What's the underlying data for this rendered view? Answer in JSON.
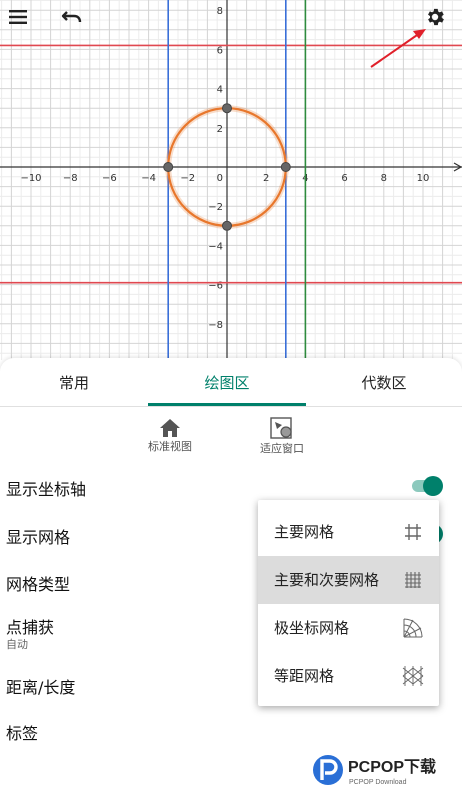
{
  "toolbar": {
    "menu_icon": "hamburger-menu-icon",
    "undo_icon": "undo-arrow-icon",
    "settings_icon": "gear-icon"
  },
  "graph": {
    "x_ticks": [
      -10,
      -8,
      -6,
      -4,
      -2,
      2,
      4,
      6,
      8,
      10
    ],
    "y_ticks": [
      8,
      6,
      4,
      2,
      -2,
      -4,
      -6,
      -8
    ],
    "origin_label": "0",
    "circle": {
      "cx": 0,
      "cy": 0,
      "r": 3
    },
    "points": [
      [
        0,
        3
      ],
      [
        3,
        0
      ],
      [
        0,
        -3
      ],
      [
        -3,
        0
      ]
    ],
    "vertical_lines": [
      {
        "x": -3,
        "color": "#3a6fd8"
      },
      {
        "x": 3,
        "color": "#3a6fd8"
      },
      {
        "x": 4,
        "color": "#2e8b3e"
      }
    ],
    "horizontal_lines": [
      {
        "y": 6.2,
        "color": "#e04850"
      },
      {
        "y": -5.9,
        "color": "#e04850"
      }
    ],
    "curve_color": "#e8772c",
    "annotation_arrow_color": "#e0202a"
  },
  "tabs": [
    {
      "label": "常用",
      "active": false
    },
    {
      "label": "绘图区",
      "active": true
    },
    {
      "label": "代数区",
      "active": false
    }
  ],
  "tools": {
    "standard_view": {
      "label": "标准视图",
      "icon": "home-icon"
    },
    "fit_window": {
      "label": "适应窗口",
      "icon": "fit-window-icon"
    }
  },
  "settings": {
    "show_axes": "显示坐标轴",
    "show_grid": "显示网格",
    "grid_type": "网格类型",
    "point_capture": "点捕获",
    "point_capture_value": "自动",
    "distance": "距离/长度",
    "labels": "标签",
    "axes_toggle_on": true,
    "grid_toggle_on": true,
    "accent": "#00806b"
  },
  "grid_menu": {
    "items": [
      {
        "label": "主要网格",
        "icon": "major-grid-icon",
        "selected": false
      },
      {
        "label": "主要和次要网格",
        "icon": "major-minor-grid-icon",
        "selected": true
      },
      {
        "label": "极坐标网格",
        "icon": "polar-grid-icon",
        "selected": false
      },
      {
        "label": "等距网格",
        "icon": "isometric-grid-icon",
        "selected": false
      }
    ]
  },
  "watermark": {
    "brand": "PCPOP下载",
    "sub": "PCPOP Download"
  }
}
